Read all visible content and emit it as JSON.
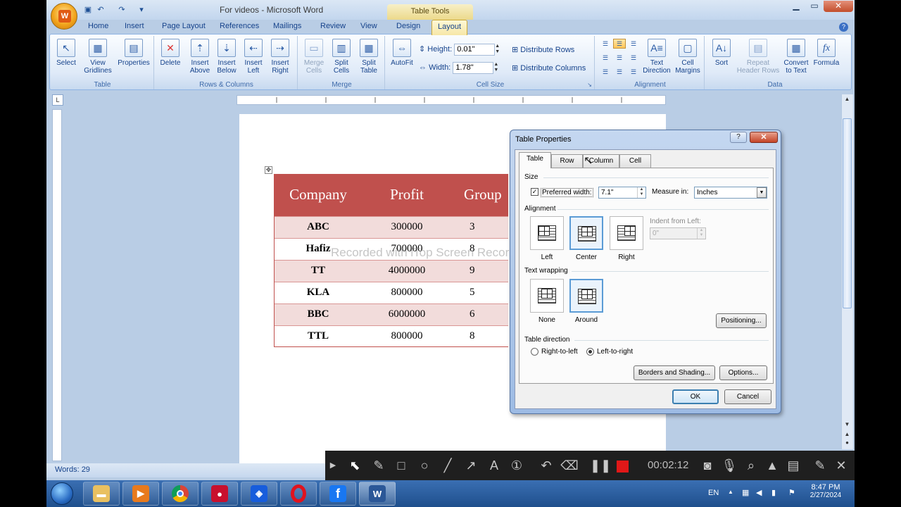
{
  "window": {
    "title": "For videos - Microsoft Word",
    "contextual_tab_group": "Table Tools"
  },
  "ribbon_tabs": [
    "Home",
    "Insert",
    "Page Layout",
    "References",
    "Mailings",
    "Review",
    "View",
    "Design",
    "Layout"
  ],
  "active_tab": "Layout",
  "ribbon": {
    "table_group": {
      "label": "Table",
      "select": "Select",
      "view_gridlines": "View Gridlines",
      "properties": "Properties"
    },
    "rows_columns_group": {
      "label": "Rows & Columns",
      "delete": "Delete",
      "insert_above": "Insert Above",
      "insert_below": "Insert Below",
      "insert_left": "Insert Left",
      "insert_right": "Insert Right"
    },
    "merge_group": {
      "label": "Merge",
      "merge_cells": "Merge Cells",
      "split_cells": "Split Cells",
      "split_table": "Split Table"
    },
    "cell_size_group": {
      "label": "Cell Size",
      "autofit": "AutoFit",
      "height_label": "Height:",
      "height_value": "0.01\"",
      "width_label": "Width:",
      "width_value": "1.78\"",
      "distribute_rows": "Distribute Rows",
      "distribute_columns": "Distribute Columns"
    },
    "alignment_group": {
      "label": "Alignment",
      "text_direction": "Text Direction",
      "cell_margins": "Cell Margins"
    },
    "data_group": {
      "label": "Data",
      "sort": "Sort",
      "repeat_header_rows": "Repeat Header Rows",
      "convert_to_text": "Convert to Text",
      "formula": "Formula"
    }
  },
  "document": {
    "headers": [
      "Company",
      "Profit",
      "Group"
    ],
    "rows": [
      {
        "company": "ABC",
        "profit": "300000",
        "group": "3"
      },
      {
        "company": "Hafiz",
        "profit": "700000",
        "group": "8"
      },
      {
        "company": "TT",
        "profit": "4000000",
        "group": "9"
      },
      {
        "company": "KLA",
        "profit": "800000",
        "group": "5"
      },
      {
        "company": "BBC",
        "profit": "6000000",
        "group": "6"
      },
      {
        "company": "TTL",
        "profit": "800000",
        "group": "8"
      }
    ],
    "watermark": "Recorded with iTop Screen Recorder",
    "header_color": "#c0504d",
    "band_color": "#f2dcdb"
  },
  "status": {
    "words": "Words: 29"
  },
  "dialog": {
    "title": "Table Properties",
    "help": "?",
    "close": "✕",
    "tabs": [
      "Table",
      "Row",
      "Column",
      "Cell"
    ],
    "active_tab": "Table",
    "size_label": "Size",
    "preferred_width_label": "Preferred width:",
    "preferred_width_checked": true,
    "preferred_width_value": "7.1\"",
    "measure_in_label": "Measure in:",
    "measure_in_value": "Inches",
    "alignment_label": "Alignment",
    "alignment_options": [
      "Left",
      "Center",
      "Right"
    ],
    "alignment_selected": "Center",
    "indent_label": "Indent from Left:",
    "indent_value": "0\"",
    "wrapping_label": "Text wrapping",
    "wrapping_options": [
      "None",
      "Around"
    ],
    "wrapping_selected": "Around",
    "positioning_button": "Positioning...",
    "direction_label": "Table direction",
    "direction_options": [
      "Right-to-left",
      "Left-to-right"
    ],
    "direction_selected": "Left-to-right",
    "borders_button": "Borders and Shading...",
    "options_button": "Options...",
    "ok_button": "OK",
    "cancel_button": "Cancel"
  },
  "recorder": {
    "elapsed": "00:02:12"
  },
  "taskbar": {
    "language": "EN",
    "time": "8:47 PM",
    "date": "2/27/2024"
  }
}
